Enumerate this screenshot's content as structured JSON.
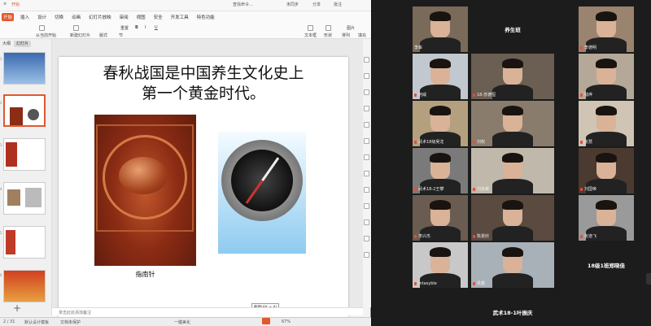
{
  "ppt": {
    "titlebar": {
      "tabs": [
        "开始"
      ],
      "search_label": "查找命令...",
      "sync_label": "未同步",
      "share_label": "分享",
      "comment_label": "批注"
    },
    "menu": [
      "开始",
      "插入",
      "设计",
      "切换",
      "动画",
      "幻灯片放映",
      "审阅",
      "视图",
      "安全",
      "开发工具",
      "特色功能"
    ],
    "active_menu": "开始",
    "ribbon": {
      "from_start": "从当前开始",
      "new_slide": "新建幻灯片",
      "layout": "版式",
      "section": "节",
      "reset": "重置",
      "textbox": "文本框",
      "shape": "形状",
      "arrange": "排列",
      "picture": "图片",
      "fill": "填充"
    },
    "thumb_tabs": [
      "大纲",
      "幻灯片"
    ],
    "thumbnails": [
      {
        "n": "1"
      },
      {
        "n": "2"
      },
      {
        "n": "3"
      },
      {
        "n": "4"
      },
      {
        "n": "5"
      },
      {
        "n": "6"
      }
    ],
    "slide": {
      "title_line1": "春秋战国是中国养生文化史上",
      "title_line2": "第一个黄金时代。",
      "caption": "指南针",
      "shortcut_tip": "截图(Alt + A)"
    },
    "notes_placeholder": "单击此处添加备注",
    "status": {
      "page": "2 / 31",
      "theme": "默认设计模板",
      "backup": "文档未保护",
      "layout_label": "一键美化",
      "zoom": "67%"
    }
  },
  "grid": {
    "tiles": [
      {
        "name": "李峯",
        "kind": "video",
        "bg": "#7a6a5a",
        "mic": false
      },
      {
        "name": "养生班",
        "kind": "text"
      },
      {
        "name": "李德明",
        "kind": "video",
        "bg": "#9a8470",
        "mic": true
      },
      {
        "name": "何威",
        "kind": "video",
        "bg": "#c2c8d0",
        "mic": true
      },
      {
        "name": "18-苏德恒",
        "kind": "video",
        "bg": "#6b5e52",
        "mic": true
      },
      {
        "name": "钱烨",
        "kind": "video",
        "bg": "#b5a898",
        "mic": true
      },
      {
        "name": "武术18级吴龙",
        "kind": "video",
        "bg": "#b4a07e",
        "mic": true
      },
      {
        "name": "刘权",
        "kind": "video",
        "bg": "#8a7c6c",
        "mic": true
      },
      {
        "name": "张慧",
        "kind": "video",
        "bg": "#d0c4b4",
        "mic": true
      },
      {
        "name": "武术18-2王攀",
        "kind": "video",
        "bg": "#7a7a7a",
        "mic": true
      },
      {
        "name": "刘永耀",
        "kind": "video",
        "bg": "#c0b8aa",
        "mic": true
      },
      {
        "name": "刘国帝",
        "kind": "video",
        "bg": "#4a3a30",
        "mic": true
      },
      {
        "name": "李兴杰",
        "kind": "video",
        "bg": "#6a5c50",
        "mic": true
      },
      {
        "name": "陈雯欣",
        "kind": "video",
        "bg": "#5a4a40",
        "mic": true
      },
      {
        "name": "张逸飞",
        "kind": "video",
        "bg": "#9a9a9a",
        "mic": true
      },
      {
        "name": "Intasyble",
        "kind": "video",
        "bg": "#c8c8c8",
        "mic": true
      },
      {
        "name": "侯鑫",
        "kind": "video",
        "bg": "#a8b0b8",
        "mic": true
      },
      {
        "name": "18级1班郑晓佳",
        "kind": "text"
      },
      {
        "name": "",
        "kind": "empty"
      },
      {
        "name": "武术18-1叶振庆",
        "kind": "text"
      },
      {
        "name": "",
        "kind": "empty"
      }
    ]
  }
}
